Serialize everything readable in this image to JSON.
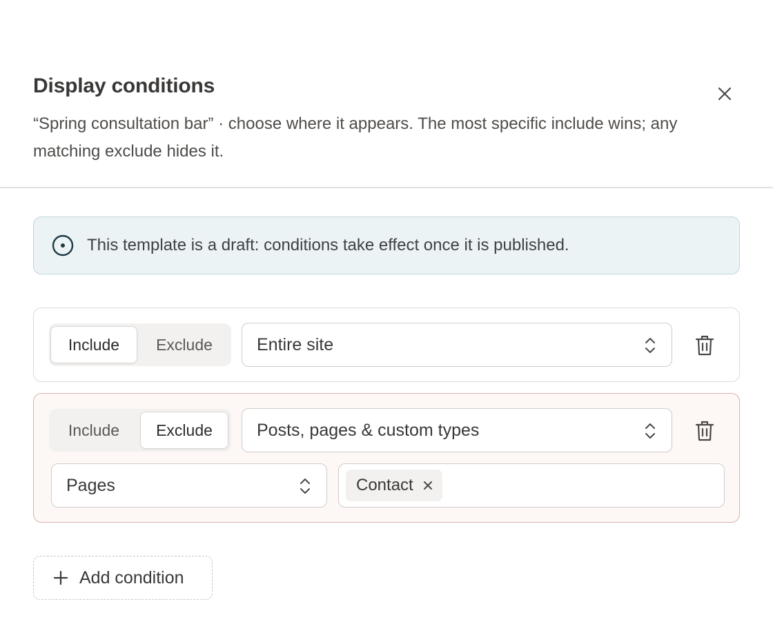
{
  "dialog": {
    "title": "Display conditions",
    "subtitle": "“Spring consultation bar” · choose where it appears. The most specific include wins; any matching exclude hides it.",
    "close_icon": "close-icon"
  },
  "notice": {
    "icon": "info-circle-icon",
    "text": "This template is a draft: conditions take effect once it is published."
  },
  "conditions": [
    {
      "include_label": "Include",
      "exclude_label": "Exclude",
      "mode": "Include",
      "scope": "Entire site",
      "delete_icon": "trash-icon"
    },
    {
      "include_label": "Include",
      "exclude_label": "Exclude",
      "mode": "Exclude",
      "scope": "Posts, pages & custom types",
      "sub_scope": "Pages",
      "tags": [
        "Contact"
      ],
      "delete_icon": "trash-icon"
    }
  ],
  "add_condition": {
    "label": "Add condition",
    "icon": "plus-icon"
  },
  "colors": {
    "notice_bg": "#ecf3f5",
    "notice_border": "#bfd6dc",
    "exclude_card_bg": "#fdf7f5",
    "exclude_card_border": "#dab2b0",
    "text": "#3a3836"
  }
}
